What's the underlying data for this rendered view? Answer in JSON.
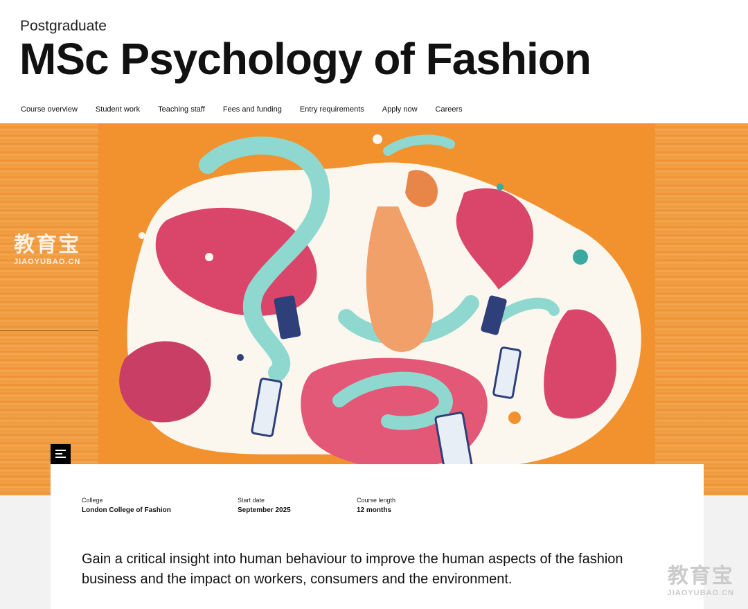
{
  "header": {
    "eyebrow": "Postgraduate",
    "title": "MSc Psychology of Fashion"
  },
  "nav": {
    "items": [
      "Course overview",
      "Student work",
      "Teaching staff",
      "Fees and funding",
      "Entry requirements",
      "Apply now",
      "Careers"
    ]
  },
  "watermark": {
    "cjk": "教育宝",
    "latin": "JIAOYUBAO.CN"
  },
  "course": {
    "college_label": "College",
    "college_value": "London College of Fashion",
    "start_label": "Start date",
    "start_value": "September 2025",
    "length_label": "Course length",
    "length_value": "12 months"
  },
  "summary": "Gain a critical insight into human behaviour to improve the human aspects of the fashion business and the impact on workers, consumers and the environment.",
  "colors": {
    "orange": "#f29a3a",
    "pink": "#d9466a",
    "mint": "#8fd8cf",
    "navy": "#2f3f7a"
  }
}
